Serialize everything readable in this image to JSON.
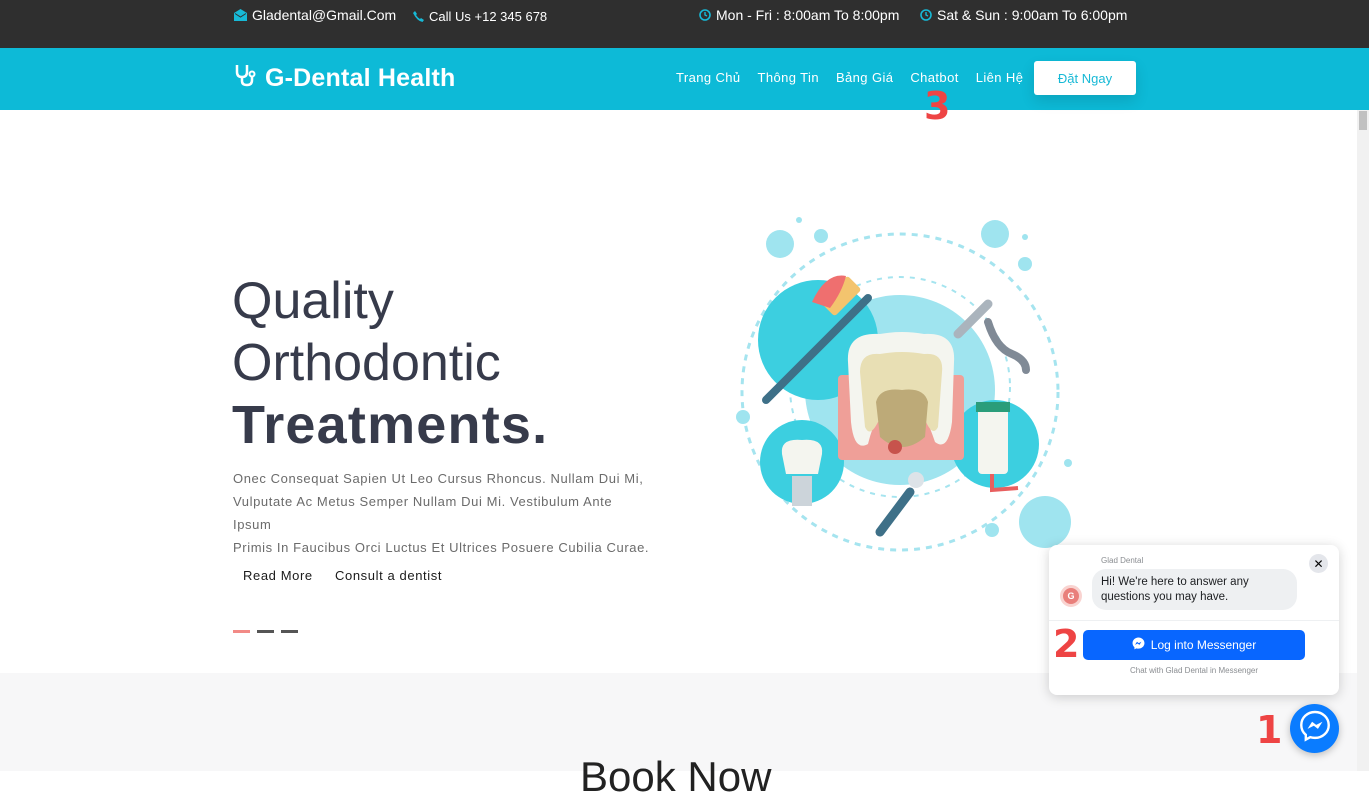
{
  "topbar": {
    "email": "Gladental@Gmail.Com",
    "phone": "Call Us +12 345 678",
    "hours_weekday": "Mon - Fri : 8:00am To 8:00pm",
    "hours_weekend": "Sat & Sun : 9:00am To 6:00pm"
  },
  "navbar": {
    "brand": "G-Dental Health",
    "links": [
      "Trang Chủ",
      "Thông Tin",
      "Bảng Giá",
      "Chatbot",
      "Liên Hệ"
    ],
    "cta": "Đặt Ngay"
  },
  "hero": {
    "line1": "Quality",
    "line2": "Orthodontic",
    "line3": "Treatments.",
    "text_line1": "Onec Consequat Sapien Ut Leo Cursus Rhoncus. Nullam Dui Mi,",
    "text_line2": "Vulputate Ac Metus Semper Nullam Dui Mi. Vestibulum Ante Ipsum",
    "text_line3": "Primis In Faucibus Orci Luctus Et Ultrices Posuere Cubilia Curae.",
    "read_more": "Read More",
    "consult": "Consult a dentist",
    "slides": 3,
    "active_slide": 1
  },
  "book_section": {
    "title": "Book Now"
  },
  "chat_widget": {
    "page_name": "Glad Dental",
    "avatar_letter": "G",
    "greeting_line1": "Hi! We're here to answer any",
    "greeting_line2": "questions you may have.",
    "login_button": "Log into Messenger",
    "footer": "Chat with Glad Dental in Messenger"
  },
  "annotations": [
    "1",
    "2",
    "3"
  ],
  "colors": {
    "topbar_bg": "#2f2f2f",
    "brand_teal": "#0dbad7",
    "heading": "#373b4b",
    "messenger_blue": "#0a7cff",
    "annotation_red": "#ee4444"
  },
  "icons": {
    "email": "envelope-icon",
    "phone": "phone-icon",
    "clock": "clock-icon",
    "brand": "stethoscope-icon",
    "messenger": "messenger-icon",
    "close": "close-icon"
  }
}
